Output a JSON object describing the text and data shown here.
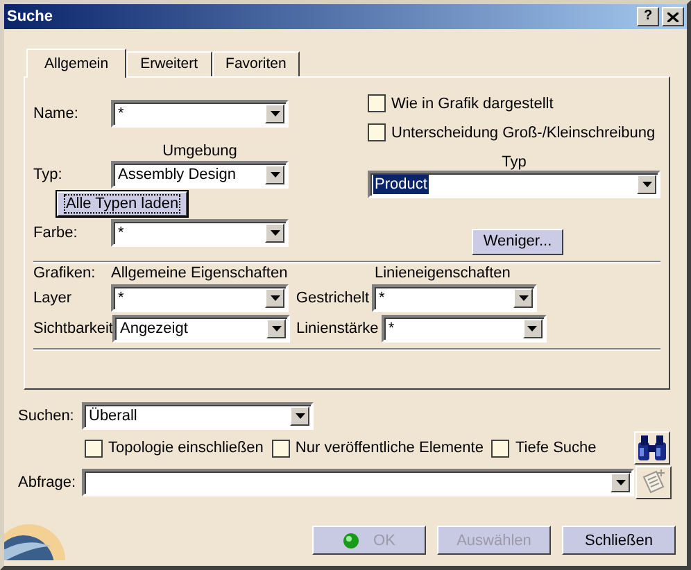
{
  "window": {
    "title": "Suche",
    "help_button": "?"
  },
  "tabs": [
    {
      "label": "Allgemein",
      "selected": true
    },
    {
      "label": "Erweitert",
      "selected": false
    },
    {
      "label": "Favoriten",
      "selected": false
    }
  ],
  "general": {
    "name": {
      "label": "Name:",
      "value": "*"
    },
    "checkboxes": [
      {
        "label": "Wie in Grafik dargestellt",
        "checked": false
      },
      {
        "label": "Unterscheidung Groß-/Kleinschreibung",
        "checked": false
      }
    ],
    "environment_caption": "Umgebung",
    "type_caption": "Typ",
    "type": {
      "label": "Typ:",
      "environment": "Assembly Design",
      "type_value": "Product",
      "type_value_highlighted": true
    },
    "load_all_button": {
      "label": "Alle Typen laden",
      "focused": true
    },
    "color": {
      "label": "Farbe:",
      "value": "*"
    },
    "less_button": {
      "label": "Weniger...",
      "focused": false
    },
    "graphics": {
      "label": "Grafiken:",
      "general_caption": "Allgemeine Eigenschaften",
      "line_caption": "Linieneigenschaften",
      "rows": [
        {
          "label": "Layer",
          "value": "*",
          "line_label": "Gestrichelt",
          "line_value": "*"
        },
        {
          "label": "Sichtbarkeit",
          "value": "Angezeigt",
          "line_label": "Linienstärke",
          "line_value": "*"
        }
      ]
    }
  },
  "search": {
    "label": "Suchen:",
    "value": "Überall",
    "options": [
      {
        "label": "Topologie einschließen",
        "checked": false
      },
      {
        "label": "Nur veröffentliche Elemente",
        "checked": false
      },
      {
        "label": "Tiefe Suche",
        "checked": false
      }
    ]
  },
  "query": {
    "label": "Abfrage:"
  },
  "buttons": [
    {
      "label": "OK",
      "disabled": true,
      "kind": "ok"
    },
    {
      "label": "Auswählen",
      "disabled": true,
      "kind": "plain"
    },
    {
      "label": "Schließen",
      "disabled": false,
      "kind": "plain"
    }
  ]
}
